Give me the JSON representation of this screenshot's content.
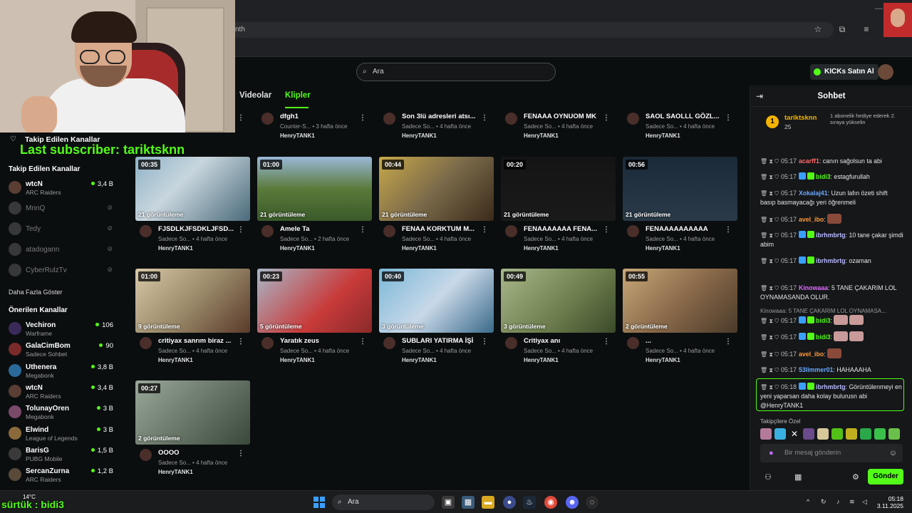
{
  "browser": {
    "url_fragment": "nth"
  },
  "page": {
    "search_placeholder": "Ara",
    "kicks_button": "KICKs Satın Al"
  },
  "overlay": {
    "follow_heading": "Takip Edilen Kanallar",
    "last_subscriber": "Last subscriber: tariktsknn",
    "bottom_text": "sürtük : bidi3",
    "weather_temp": "14°C"
  },
  "sidebar": {
    "followed_heading": "Takip Edilen Kanallar",
    "followed": [
      {
        "name": "wtcN",
        "category": "ARC Raiders",
        "count": "3,4 B",
        "online": true
      },
      {
        "name": "MnnQ",
        "online": false
      },
      {
        "name": "Tedy",
        "online": false
      },
      {
        "name": "atadogann",
        "online": false
      },
      {
        "name": "CyberRulzTv",
        "online": false
      }
    ],
    "show_more": "Daha Fazla Göster",
    "recommended_heading": "Önerilen Kanallar",
    "recommended": [
      {
        "name": "Vechiron",
        "category": "Warframe",
        "count": "106"
      },
      {
        "name": "GalaCimBom",
        "category": "Sadece Sohbet",
        "count": "90"
      },
      {
        "name": "Uthenera",
        "category": "Megabonk",
        "count": "3,8 B"
      },
      {
        "name": "wtcN",
        "category": "ARC Raiders",
        "count": "3,4 B"
      },
      {
        "name": "TolunayOren",
        "category": "Megabonk",
        "count": "3 B"
      },
      {
        "name": "Elwind",
        "category": "League of Legends",
        "count": "3 B"
      },
      {
        "name": "BarisG",
        "category": "PUBG Mobile",
        "count": "1,5 B"
      },
      {
        "name": "SercanZurna",
        "category": "ARC Raiders",
        "count": "1,2 B"
      }
    ]
  },
  "tabs": {
    "videos": "Videolar",
    "clips": "Klipler"
  },
  "clips_top_row": [
    {
      "title": "dfgh1",
      "category": "Counter-S...",
      "age": "3 hafta önce",
      "author": "HenryTANK1"
    },
    {
      "title": "Son 3lü adresleri atsı...",
      "category": "Sadece So...",
      "age": "4 hafta önce",
      "author": "HenryTANK1"
    },
    {
      "title": "FENAAA OYNUOM MK",
      "category": "Sadece So...",
      "age": "4 hafta önce",
      "author": "HenryTANK1"
    },
    {
      "title": "SAOL SAOLLL GÖZL...",
      "category": "Sadece So...",
      "age": "4 hafta önce",
      "author": "HenryTANK1"
    }
  ],
  "top_row_author_first": "HenryTANK1",
  "clips": [
    {
      "duration": "00:35",
      "views": "21 görüntüleme",
      "title": "FJSDLKJFSDKLJFSD...",
      "category": "Sadece So...",
      "age": "4 hafta önce",
      "author": "HenryTANK1"
    },
    {
      "duration": "01:00",
      "views": "21 görüntüleme",
      "title": "Amele Ta",
      "category": "Sadece So...",
      "age": "2 hafta önce",
      "author": "HenryTANK1"
    },
    {
      "duration": "00:44",
      "views": "21 görüntüleme",
      "title": "FENAA KORKTUM M...",
      "category": "Sadece So...",
      "age": "4 hafta önce",
      "author": "HenryTANK1"
    },
    {
      "duration": "00:20",
      "views": "21 görüntüleme",
      "title": "FENAAAAAAA FENA...",
      "category": "Sadece So...",
      "age": "4 hafta önce",
      "author": "HenryTANK1"
    },
    {
      "duration": "00:56",
      "views": "21 görüntüleme",
      "title": "FENAAAAAAAAAA",
      "category": "Sadece So...",
      "age": "4 hafta önce",
      "author": "HenryTANK1"
    },
    {
      "duration": "01:00",
      "views": "9 görüntüleme",
      "title": "critiyax sanrım biraz ...",
      "category": "Sadece So...",
      "age": "4 hafta önce",
      "author": "HenryTANK1"
    },
    {
      "duration": "00:23",
      "views": "5 görüntüleme",
      "title": "Yaratık zeus",
      "category": "Sadece So...",
      "age": "4 hafta önce",
      "author": "HenryTANK1"
    },
    {
      "duration": "00:40",
      "views": "3 görüntüleme",
      "title": "SUBLARI YATIRMA İŞİ",
      "category": "Sadece So...",
      "age": "4 hafta önce",
      "author": "HenryTANK1"
    },
    {
      "duration": "00:49",
      "views": "3 görüntüleme",
      "title": "Critiyax anı",
      "category": "Sadece So...",
      "age": "4 hafta önce",
      "author": "HenryTANK1"
    },
    {
      "duration": "00:55",
      "views": "2 görüntüleme",
      "title": "...",
      "category": "Sadece So...",
      "age": "4 hafta önce",
      "author": "HenryTANK1"
    },
    {
      "duration": "00:27",
      "views": "2 görüntüleme",
      "title": "OOOO",
      "category": "Sadece So...",
      "age": "4 hafta önce",
      "author": "HenryTANK1"
    }
  ],
  "chat": {
    "title": "Sohbet",
    "pinned_user": "tariktsknn",
    "pinned_count": "25",
    "pinned_desc": "1 abonelik hediye ederek 2. sıraya yükselin",
    "messages": [
      {
        "time": "05:17",
        "user": "acarff1",
        "color": "#ff6a6a",
        "text": "canın sağolsun ta abi"
      },
      {
        "time": "05:17",
        "user": "bidi3",
        "color": "#53fc18",
        "text": "estagfurullah"
      },
      {
        "time": "05:17",
        "user": "Xokalaj41",
        "color": "#6aa8ff",
        "text": "Uzun lafın özeti shift basıp basmayacağı yeri öğrenmeli"
      },
      {
        "time": "05:17",
        "user": "avel_ibo",
        "color": "#ff9a3a",
        "text": ""
      },
      {
        "time": "05:17",
        "user": "ibrhmbrtg",
        "color": "#b8b8ff",
        "text": "10 tane çakar şimdi abim"
      },
      {
        "time": "05:17",
        "user": "ibrhmbrtg",
        "color": "#b8b8ff",
        "text": "ozaman"
      },
      {
        "time": "05:17",
        "user": "Kinowaaa",
        "color": "#e26aff",
        "text": "5 TANE ÇAKARIM LOL OYNAMASANDA OLUR."
      },
      {
        "time": "05:17",
        "user": "bidi3",
        "color": "#53fc18",
        "text": ""
      },
      {
        "time": "05:17",
        "user": "bidi3",
        "color": "#53fc18",
        "text": ""
      },
      {
        "time": "05:17",
        "user": "avel_ibo",
        "color": "#ff9a3a",
        "text": ""
      },
      {
        "time": "05:17",
        "user": "53limmer01",
        "color": "#6aa8ff",
        "text": "HAHAAAHA"
      },
      {
        "time": "05:18",
        "user": "ibrhmbrtg",
        "color": "#b8b8ff",
        "text": "Görüntülenmeyi en yeni yaparsan daha kolay bulurusn abi @HenryTANK1"
      }
    ],
    "reply_preview": "Kinowaaa: 5 TANE ÇAKARIM LOL OYNAMASA...",
    "follower_label": "Takipçilere Özel",
    "input_placeholder": "Bir mesaj gönderin",
    "send_button": "Gönder"
  },
  "taskbar": {
    "search_placeholder": "Ara",
    "time": "05:18",
    "date": "3.11.2025"
  }
}
